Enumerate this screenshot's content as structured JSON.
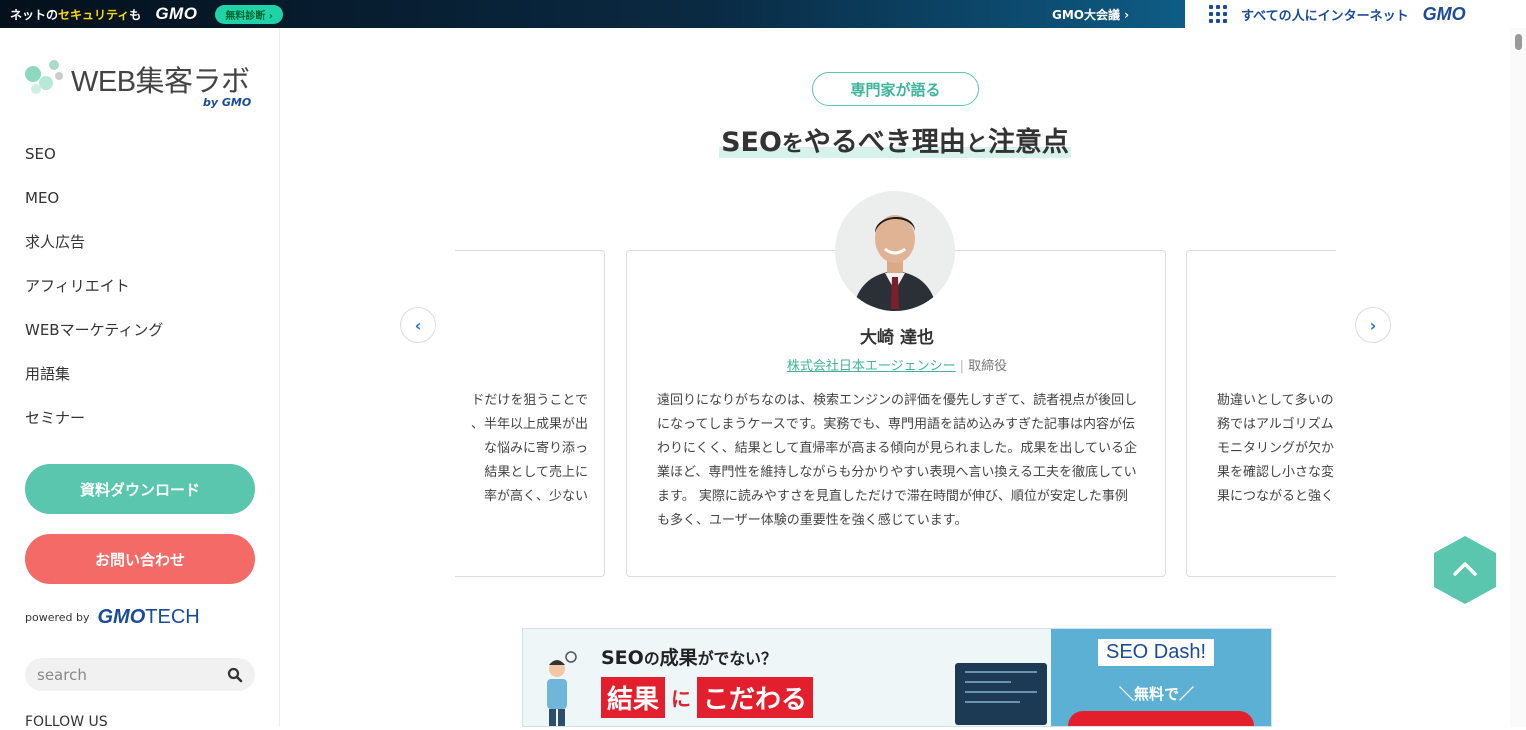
{
  "topbar": {
    "left_prefix": "ネットの",
    "left_highlight": "セキュリティ",
    "left_suffix": "も",
    "gmo_logo": "GMO",
    "diagnosis_button": "無料診断 ›",
    "summit_link": "GMO大会議 ›",
    "right_text": "すべての人にインターネット",
    "right_logo": "GMO"
  },
  "sidebar": {
    "logo_text": "WEB集客ラボ",
    "logo_by": "by GMO",
    "nav": [
      "SEO",
      "MEO",
      "求人広告",
      "アフィリエイト",
      "WEBマーケティング",
      "用語集",
      "セミナー"
    ],
    "download_button": "資料ダウンロード",
    "contact_button": "お問い合わせ",
    "powered_by": "powered by",
    "powered_logo_bold": "GMO",
    "powered_logo_light": "TECH",
    "search_placeholder": "search",
    "follow_label": "FOLLOW US"
  },
  "main": {
    "tag": "専門家が語る",
    "heading_a": "SEO",
    "heading_b": "を",
    "heading_c": "やるべき理由",
    "heading_d": "と",
    "heading_e": "注意点",
    "prev_arrow": "‹",
    "next_arrow": "›",
    "center_card": {
      "name": "大崎 達也",
      "company": "株式会社日本エージェンシー",
      "separator": "|",
      "role": "取締役",
      "quote": "遠回りになりがちなのは、検索エンジンの評価を優先しすぎて、読者視点が後回しになってしまうケースです。実務でも、専門用語を詰め込みすぎた記事は内容が伝わりにくく、結果として直帰率が高まる傾向が見られました。成果を出している企業ほど、専門性を維持しながらも分かりやすい表現へ言い換える工夫を徹底しています。 実際に読みやすさを見直しただけで滞在時間が伸び、順位が安定した事例も多く、ユーザー体験の重要性を強く感じています。"
    },
    "left_card_lines": [
      "ドだけを狙うことで",
      "、半年以上成果が出",
      "な悩みに寄り添っ",
      "結果として売上に",
      "率が高く、少ない"
    ],
    "right_card_lines": [
      "勘違いとして多いの",
      "務ではアルゴリズム",
      "モニタリングが欠か",
      "果を確認し小さな変",
      "果につながると強く"
    ]
  },
  "banner": {
    "headline_a": "SEO",
    "headline_b": "の",
    "headline_c": "成果",
    "headline_d": "がでない？",
    "word1": "結果",
    "word_ni": "に",
    "word2": "こだわる",
    "product": "SEO Dash!",
    "free_label": "＼無料で／"
  },
  "colors": {
    "accent": "#59c6ad",
    "contact": "#f46a67",
    "gmo_blue": "#1a4b9b",
    "banner_red": "#e41f2d"
  }
}
